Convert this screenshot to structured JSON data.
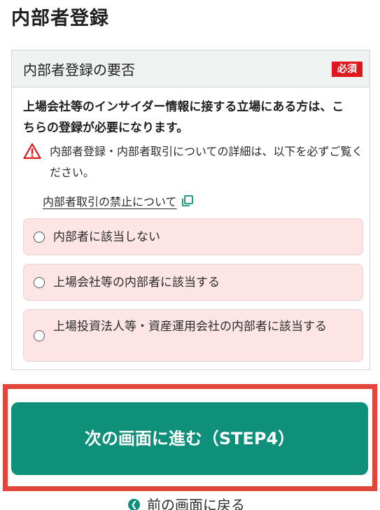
{
  "page": {
    "title": "内部者登録"
  },
  "card": {
    "title": "内部者登録の要否",
    "required_badge": "必須",
    "description": "上場会社等のインサイダー情報に接する立場にある方は、こちらの登録が必要になります。",
    "warning": "内部者登録・内部者取引についての詳細は、以下を必ずご覧ください。",
    "link": "内部者取引の禁止について",
    "options": [
      {
        "label": "内部者に該当しない",
        "selected": false
      },
      {
        "label": "上場会社等の内部者に該当する",
        "selected": false
      },
      {
        "label": "上場投資法人等・資産運用会社の内部者に該当する",
        "selected": false
      }
    ]
  },
  "actions": {
    "next_label": "次の画面に進む（STEP4）",
    "back_label": "前の画面に戻る"
  },
  "colors": {
    "primary": "#0f907a",
    "required_badge": "#e0181e",
    "option_background": "#fde5e6",
    "highlight_border": "#e2463a"
  },
  "icons": {
    "warning": "warning-triangle-icon",
    "external_link": "external-link-icon",
    "back": "chevron-left-icon"
  }
}
